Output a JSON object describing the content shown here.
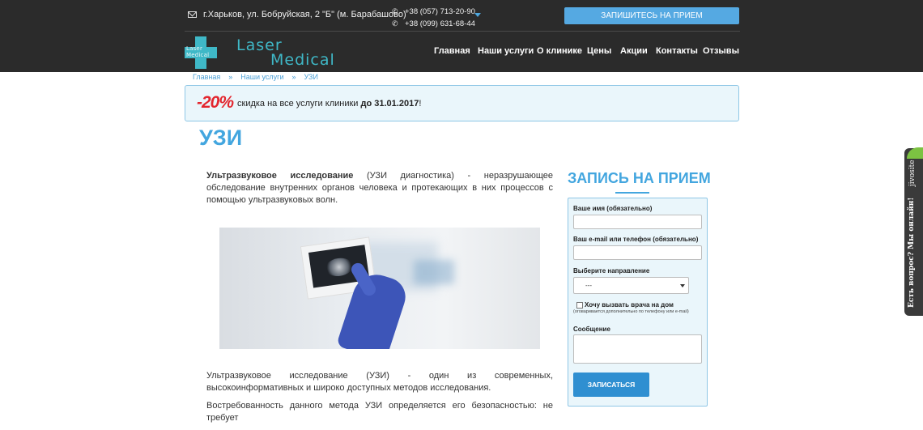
{
  "header": {
    "address": "г.Харьков, ул. Бобруйская, 2 \"Б\" (м. Барабашово)",
    "phones": [
      "+38 (057) 713-20-90",
      "+38 (099) 631-68-44"
    ],
    "appointment_button": "ЗАПИШИТЕСЬ НА ПРИЕМ",
    "logo": {
      "cross_line1": "Laser",
      "cross_line2": "Medical",
      "line1": "Laser",
      "line2": "Medical"
    },
    "nav": [
      "Главная",
      "Наши услуги",
      "О клинике",
      "Цены",
      "Акции",
      "Контакты",
      "Отзывы"
    ]
  },
  "breadcrumbs": [
    "Главная",
    "Наши услуги",
    "УЗИ"
  ],
  "breadcrumb_separator": "»",
  "promo": {
    "percent": "-20%",
    "text": "скидка на все услуги клиники",
    "date": "до 31.01.2017",
    "tail": "!"
  },
  "page_title": "УЗИ",
  "content": {
    "intro_bold": "Ультразвуковое исследование",
    "intro_rest": " (УЗИ диагностика) - неразрушающее обследование внутренних органов человека и протекающих в них процессов с помощью ультразвуковых волн.",
    "para2": "Ультразвуковое исследование (УЗИ) - один из современных, высокоинформативных и широко доступных методов исследования.",
    "para3": "Востребованность данного метода УЗИ определяется его безопасностью: не требует"
  },
  "form": {
    "title": "ЗАПИСЬ НА ПРИЕМ",
    "name_label": "Ваше имя (обязательно)",
    "contact_label": "Ваш e-mail или телефон (обязательно)",
    "direction_label": "Выберите направление",
    "direction_value": "---",
    "home_visit_label": "Хочу вызвать врача на дом",
    "home_visit_note": "(оговаривается дополнительно по телефону или e-mail)",
    "message_label": "Сообщение",
    "submit": "ЗАПИСАТЬСЯ"
  },
  "jivosite": {
    "brand": "jivosite",
    "text": "Есть вопрос? Мы онлайн!"
  },
  "colors": {
    "header_bg": "#2b2b2b",
    "accent_blue": "#43a6df",
    "logo_teal": "#3fb8c7",
    "promo_red": "#e3262e",
    "form_bg": "#eaf6fb"
  }
}
